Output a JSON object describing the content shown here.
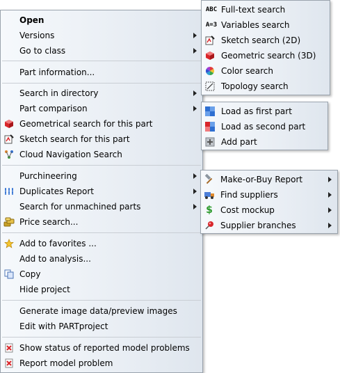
{
  "main_menu": {
    "items": [
      {
        "label": "Open",
        "bold": true
      },
      {
        "label": "Versions",
        "submenu": true
      },
      {
        "label": "Go to class",
        "submenu": true
      },
      {
        "label": "Part information..."
      },
      {
        "label": "Search in directory",
        "submenu": true
      },
      {
        "label": "Part comparison",
        "submenu": true
      },
      {
        "label": "Geometrical search for this part",
        "icon": "red-cube-icon"
      },
      {
        "label": "Sketch search for this part",
        "icon": "sketch-icon"
      },
      {
        "label": "Cloud Navigation Search",
        "icon": "cloud-navigation-icon"
      },
      {
        "label": "Purchineering",
        "submenu": true
      },
      {
        "label": "Duplicates Report",
        "icon": "duplicates-icon",
        "submenu": true
      },
      {
        "label": "Search for unmachined parts",
        "submenu": true
      },
      {
        "label": "Price search...",
        "icon": "coins-icon"
      },
      {
        "label": "Add to favorites ...",
        "icon": "star-icon"
      },
      {
        "label": "Add to analysis..."
      },
      {
        "label": "Copy",
        "icon": "copy-icon"
      },
      {
        "label": "Hide project"
      },
      {
        "label": "Generate image data/preview images"
      },
      {
        "label": "Edit with PARTproject"
      },
      {
        "label": "Show status of reported model problems",
        "icon": "report-status-icon"
      },
      {
        "label": "Report model problem",
        "icon": "report-problem-icon"
      }
    ]
  },
  "search_submenu": {
    "items": [
      {
        "label": "Full-text search",
        "icon_text": "ABC",
        "icon": "abc-text-icon"
      },
      {
        "label": "Variables search",
        "icon_text": "A=3",
        "icon": "variables-icon"
      },
      {
        "label": "Sketch search (2D)",
        "icon": "sketch-icon"
      },
      {
        "label": "Geometric search (3D)",
        "icon": "red-cube-icon"
      },
      {
        "label": "Color search",
        "icon": "color-wheel-icon"
      },
      {
        "label": "Topology search",
        "icon": "topology-icon"
      }
    ]
  },
  "comparison_submenu": {
    "items": [
      {
        "label": "Load as first part",
        "icon": "load-first-icon"
      },
      {
        "label": "Load as second part",
        "icon": "load-second-icon"
      },
      {
        "label": "Add part",
        "icon": "add-part-icon"
      }
    ]
  },
  "purchineering_submenu": {
    "items": [
      {
        "label": "Make-or-Buy Report",
        "icon": "hammer-icon",
        "submenu": true
      },
      {
        "label": "Find suppliers",
        "icon": "truck-icon",
        "submenu": true
      },
      {
        "label": "Cost mockup",
        "icon": "dollar-icon",
        "submenu": true
      },
      {
        "label": "Supplier branches",
        "icon": "pin-icon",
        "submenu": true
      }
    ]
  },
  "colors": {
    "menu_bg": "#eef2f6",
    "separator": "#c9ced4",
    "accent_red": "#d9262b",
    "accent_blue": "#2f6fd1"
  }
}
